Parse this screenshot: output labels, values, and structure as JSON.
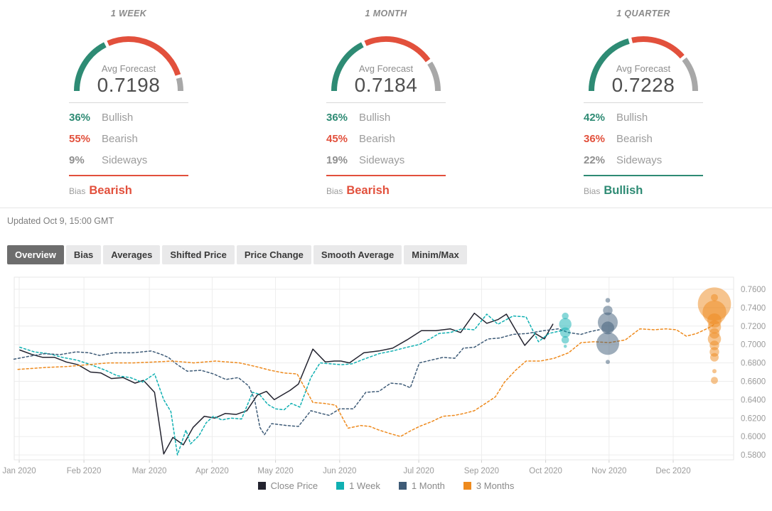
{
  "updated_text": "Updated Oct 9, 15:00 GMT",
  "colors": {
    "bullish": "#2e8b74",
    "bearish": "#e2503c",
    "sideways": "#8f8f8f",
    "arc_sideways": "#a8a8a8",
    "grid": "#ededed",
    "plot_border": "#e7e7e7",
    "axis_text": "#9b9b9b"
  },
  "panels": [
    {
      "title": "1 WEEK",
      "avg_label": "Avg Forecast",
      "avg_value": "0.7198",
      "rows": [
        {
          "pct": 36,
          "label": "Bullish",
          "type": "bullish"
        },
        {
          "pct": 55,
          "label": "Bearish",
          "type": "bearish"
        },
        {
          "pct": 9,
          "label": "Sideways",
          "type": "sideways"
        }
      ],
      "bias_label": "Bias",
      "bias_value": "Bearish",
      "bias_type": "bearish"
    },
    {
      "title": "1 MONTH",
      "avg_label": "Avg Forecast",
      "avg_value": "0.7184",
      "rows": [
        {
          "pct": 36,
          "label": "Bullish",
          "type": "bullish"
        },
        {
          "pct": 45,
          "label": "Bearish",
          "type": "bearish"
        },
        {
          "pct": 19,
          "label": "Sideways",
          "type": "sideways"
        }
      ],
      "bias_label": "Bias",
      "bias_value": "Bearish",
      "bias_type": "bearish"
    },
    {
      "title": "1 QUARTER",
      "avg_label": "Avg Forecast",
      "avg_value": "0.7228",
      "rows": [
        {
          "pct": 42,
          "label": "Bullish",
          "type": "bullish"
        },
        {
          "pct": 36,
          "label": "Bearish",
          "type": "bearish"
        },
        {
          "pct": 22,
          "label": "Sideways",
          "type": "sideways"
        }
      ],
      "bias_label": "Bias",
      "bias_value": "Bullish",
      "bias_type": "bullish"
    }
  ],
  "tabs": [
    {
      "label": "Overview",
      "active": true
    },
    {
      "label": "Bias",
      "active": false
    },
    {
      "label": "Averages",
      "active": false
    },
    {
      "label": "Shifted Price",
      "active": false
    },
    {
      "label": "Price Change",
      "active": false
    },
    {
      "label": "Smooth Average",
      "active": false
    },
    {
      "label": "Minim/Max",
      "active": false
    }
  ],
  "chart_data": {
    "type": "line",
    "title": "",
    "xlabel": "",
    "ylabel": "",
    "ylim": [
      0.58,
      0.76
    ],
    "grid": true,
    "legend_position": "bottom",
    "y_ticks": [
      "0.7600",
      "0.7400",
      "0.7200",
      "0.7000",
      "0.6800",
      "0.6600",
      "0.6400",
      "0.6200",
      "0.6000",
      "0.5800"
    ],
    "x_ticks": [
      {
        "label": "Jan 2020",
        "pos": 0.0
      },
      {
        "label": "Feb 2020",
        "pos": 0.099
      },
      {
        "label": "Mar 2020",
        "pos": 0.199
      },
      {
        "label": "Apr 2020",
        "pos": 0.295
      },
      {
        "label": "May 2020",
        "pos": 0.392
      },
      {
        "label": "Jun 2020",
        "pos": 0.49
      },
      {
        "label": "Jul 2020",
        "pos": 0.611
      },
      {
        "label": "Sep 2020",
        "pos": 0.707
      },
      {
        "label": "Oct 2020",
        "pos": 0.805
      },
      {
        "label": "Nov 2020",
        "pos": 0.902
      },
      {
        "label": "Dec 2020",
        "pos": 1.0
      }
    ],
    "series": [
      {
        "name": "Close Price",
        "color": "#23232f",
        "dash": false,
        "points": [
          [
            0.001,
            0.694
          ],
          [
            0.02,
            0.689
          ],
          [
            0.036,
            0.686
          ],
          [
            0.054,
            0.686
          ],
          [
            0.072,
            0.681
          ],
          [
            0.09,
            0.678
          ],
          [
            0.109,
            0.67
          ],
          [
            0.125,
            0.669
          ],
          [
            0.141,
            0.663
          ],
          [
            0.159,
            0.664
          ],
          [
            0.177,
            0.658
          ],
          [
            0.19,
            0.661
          ],
          [
            0.207,
            0.648
          ],
          [
            0.221,
            0.581
          ],
          [
            0.235,
            0.599
          ],
          [
            0.251,
            0.591
          ],
          [
            0.266,
            0.61
          ],
          [
            0.283,
            0.622
          ],
          [
            0.299,
            0.62
          ],
          [
            0.315,
            0.625
          ],
          [
            0.332,
            0.624
          ],
          [
            0.348,
            0.628
          ],
          [
            0.364,
            0.645
          ],
          [
            0.378,
            0.649
          ],
          [
            0.39,
            0.64
          ],
          [
            0.402,
            0.645
          ],
          [
            0.414,
            0.65
          ],
          [
            0.427,
            0.657
          ],
          [
            0.449,
            0.695
          ],
          [
            0.468,
            0.681
          ],
          [
            0.482,
            0.682
          ],
          [
            0.492,
            0.682
          ],
          [
            0.505,
            0.68
          ],
          [
            0.527,
            0.691
          ],
          [
            0.55,
            0.693
          ],
          [
            0.571,
            0.696
          ],
          [
            0.593,
            0.705
          ],
          [
            0.615,
            0.715
          ],
          [
            0.637,
            0.715
          ],
          [
            0.659,
            0.717
          ],
          [
            0.675,
            0.713
          ],
          [
            0.696,
            0.734
          ],
          [
            0.715,
            0.723
          ],
          [
            0.732,
            0.727
          ],
          [
            0.745,
            0.733
          ],
          [
            0.758,
            0.717
          ],
          [
            0.773,
            0.699
          ],
          [
            0.789,
            0.712
          ],
          [
            0.803,
            0.706
          ],
          [
            0.816,
            0.722
          ]
        ]
      },
      {
        "name": "1 Week",
        "color": "#10b0b2",
        "dash": true,
        "points": [
          [
            0.001,
            0.697
          ],
          [
            0.023,
            0.692
          ],
          [
            0.045,
            0.69
          ],
          [
            0.066,
            0.686
          ],
          [
            0.088,
            0.683
          ],
          [
            0.11,
            0.678
          ],
          [
            0.132,
            0.672
          ],
          [
            0.15,
            0.666
          ],
          [
            0.17,
            0.664
          ],
          [
            0.188,
            0.659
          ],
          [
            0.207,
            0.668
          ],
          [
            0.221,
            0.64
          ],
          [
            0.232,
            0.627
          ],
          [
            0.242,
            0.58
          ],
          [
            0.255,
            0.607
          ],
          [
            0.262,
            0.592
          ],
          [
            0.275,
            0.601
          ],
          [
            0.286,
            0.615
          ],
          [
            0.297,
            0.622
          ],
          [
            0.31,
            0.618
          ],
          [
            0.324,
            0.62
          ],
          [
            0.34,
            0.619
          ],
          [
            0.357,
            0.648
          ],
          [
            0.367,
            0.646
          ],
          [
            0.38,
            0.635
          ],
          [
            0.392,
            0.63
          ],
          [
            0.405,
            0.629
          ],
          [
            0.416,
            0.636
          ],
          [
            0.429,
            0.632
          ],
          [
            0.446,
            0.664
          ],
          [
            0.46,
            0.68
          ],
          [
            0.476,
            0.679
          ],
          [
            0.492,
            0.678
          ],
          [
            0.509,
            0.679
          ],
          [
            0.527,
            0.684
          ],
          [
            0.55,
            0.69
          ],
          [
            0.571,
            0.693
          ],
          [
            0.593,
            0.697
          ],
          [
            0.612,
            0.7
          ],
          [
            0.628,
            0.706
          ],
          [
            0.642,
            0.712
          ],
          [
            0.659,
            0.713
          ],
          [
            0.677,
            0.717
          ],
          [
            0.696,
            0.716
          ],
          [
            0.715,
            0.733
          ],
          [
            0.732,
            0.722
          ],
          [
            0.745,
            0.727
          ],
          [
            0.755,
            0.731
          ],
          [
            0.775,
            0.73
          ],
          [
            0.794,
            0.703
          ],
          [
            0.81,
            0.712
          ],
          [
            0.829,
            0.715
          ]
        ]
      },
      {
        "name": "1 Month",
        "color": "#3e5b77",
        "dash": true,
        "points": [
          [
            -0.008,
            0.684
          ],
          [
            0.014,
            0.687
          ],
          [
            0.038,
            0.69
          ],
          [
            0.063,
            0.689
          ],
          [
            0.087,
            0.692
          ],
          [
            0.107,
            0.691
          ],
          [
            0.123,
            0.688
          ],
          [
            0.145,
            0.691
          ],
          [
            0.174,
            0.691
          ],
          [
            0.202,
            0.693
          ],
          [
            0.218,
            0.689
          ],
          [
            0.228,
            0.686
          ],
          [
            0.242,
            0.678
          ],
          [
            0.257,
            0.671
          ],
          [
            0.278,
            0.672
          ],
          [
            0.297,
            0.668
          ],
          [
            0.316,
            0.662
          ],
          [
            0.335,
            0.664
          ],
          [
            0.351,
            0.655
          ],
          [
            0.36,
            0.64
          ],
          [
            0.368,
            0.61
          ],
          [
            0.375,
            0.602
          ],
          [
            0.386,
            0.614
          ],
          [
            0.409,
            0.612
          ],
          [
            0.427,
            0.611
          ],
          [
            0.446,
            0.628
          ],
          [
            0.462,
            0.625
          ],
          [
            0.474,
            0.623
          ],
          [
            0.49,
            0.63
          ],
          [
            0.511,
            0.63
          ],
          [
            0.53,
            0.648
          ],
          [
            0.55,
            0.649
          ],
          [
            0.568,
            0.658
          ],
          [
            0.585,
            0.657
          ],
          [
            0.598,
            0.653
          ],
          [
            0.612,
            0.68
          ],
          [
            0.63,
            0.683
          ],
          [
            0.648,
            0.686
          ],
          [
            0.666,
            0.685
          ],
          [
            0.679,
            0.696
          ],
          [
            0.696,
            0.697
          ],
          [
            0.717,
            0.706
          ],
          [
            0.735,
            0.707
          ],
          [
            0.755,
            0.711
          ],
          [
            0.777,
            0.712
          ],
          [
            0.802,
            0.715
          ],
          [
            0.824,
            0.717
          ],
          [
            0.84,
            0.713
          ],
          [
            0.859,
            0.711
          ],
          [
            0.873,
            0.714
          ],
          [
            0.887,
            0.716
          ]
        ]
      },
      {
        "name": "3 Months",
        "color": "#ee8a1d",
        "dash": true,
        "points": [
          [
            -0.002,
            0.673
          ],
          [
            0.02,
            0.674
          ],
          [
            0.039,
            0.675
          ],
          [
            0.072,
            0.676
          ],
          [
            0.104,
            0.678
          ],
          [
            0.137,
            0.68
          ],
          [
            0.174,
            0.68
          ],
          [
            0.207,
            0.681
          ],
          [
            0.235,
            0.682
          ],
          [
            0.267,
            0.68
          ],
          [
            0.3,
            0.682
          ],
          [
            0.337,
            0.68
          ],
          [
            0.362,
            0.676
          ],
          [
            0.384,
            0.672
          ],
          [
            0.405,
            0.669
          ],
          [
            0.425,
            0.668
          ],
          [
            0.449,
            0.637
          ],
          [
            0.467,
            0.636
          ],
          [
            0.484,
            0.634
          ],
          [
            0.503,
            0.609
          ],
          [
            0.522,
            0.612
          ],
          [
            0.536,
            0.611
          ],
          [
            0.55,
            0.607
          ],
          [
            0.568,
            0.603
          ],
          [
            0.583,
            0.6
          ],
          [
            0.598,
            0.606
          ],
          [
            0.612,
            0.611
          ],
          [
            0.63,
            0.616
          ],
          [
            0.648,
            0.622
          ],
          [
            0.666,
            0.623
          ],
          [
            0.68,
            0.625
          ],
          [
            0.696,
            0.628
          ],
          [
            0.713,
            0.636
          ],
          [
            0.728,
            0.643
          ],
          [
            0.742,
            0.659
          ],
          [
            0.759,
            0.672
          ],
          [
            0.775,
            0.682
          ],
          [
            0.797,
            0.682
          ],
          [
            0.818,
            0.685
          ],
          [
            0.84,
            0.691
          ],
          [
            0.859,
            0.702
          ],
          [
            0.88,
            0.703
          ],
          [
            0.902,
            0.702
          ],
          [
            0.927,
            0.705
          ],
          [
            0.949,
            0.717
          ],
          [
            0.971,
            0.716
          ],
          [
            0.989,
            0.717
          ],
          [
            1.005,
            0.716
          ],
          [
            1.02,
            0.709
          ],
          [
            1.036,
            0.712
          ],
          [
            1.054,
            0.718
          ],
          [
            1.063,
            0.722
          ]
        ]
      }
    ],
    "bubble_clusters": [
      {
        "name": "1 Week forecasts",
        "color": "#10b0b2",
        "pos": 0.835,
        "points": [
          [
            0.731,
            4.7
          ],
          [
            0.722,
            8.7
          ],
          [
            0.713,
            7.3
          ],
          [
            0.705,
            5.3
          ],
          [
            0.698,
            2.3
          ]
        ]
      },
      {
        "name": "1 Month forecasts",
        "color": "#3e5b77",
        "pos": 0.9,
        "points": [
          [
            0.748,
            3.3
          ],
          [
            0.737,
            6.7
          ],
          [
            0.724,
            14
          ],
          [
            0.718,
            9
          ],
          [
            0.701,
            16
          ],
          [
            0.681,
            3
          ]
        ]
      },
      {
        "name": "3 Months forecasts",
        "color": "#ee8a1d",
        "pos": 1.063,
        "points": [
          [
            0.751,
            5
          ],
          [
            0.744,
            23.3
          ],
          [
            0.735,
            16.7
          ],
          [
            0.726,
            10
          ],
          [
            0.719,
            9.3
          ],
          [
            0.712,
            7.3
          ],
          [
            0.706,
            9.3
          ],
          [
            0.699,
            6.7
          ],
          [
            0.692,
            6.7
          ],
          [
            0.686,
            6
          ],
          [
            0.671,
            3
          ],
          [
            0.661,
            5
          ]
        ]
      }
    ],
    "legend": [
      {
        "label": "Close Price",
        "color": "#23232f"
      },
      {
        "label": "1 Week",
        "color": "#10b0b2"
      },
      {
        "label": "1 Month",
        "color": "#3e5b77"
      },
      {
        "label": "3 Months",
        "color": "#ee8a1d"
      }
    ]
  }
}
